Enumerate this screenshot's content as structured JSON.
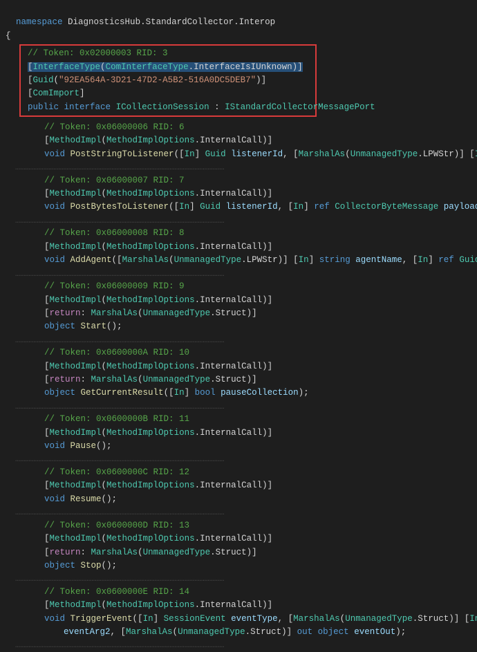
{
  "ns_kw": "namespace",
  "ns_name": "DiagnosticsHub.StandardCollector.Interop",
  "brace_open": "{",
  "brace_close": "}",
  "header": {
    "cmt": "// Token: 0x02000003 RID: 3",
    "it_attr_open": "[",
    "it_attr": "InterfaceType",
    "it_attr_arg_ns": "ComInterfaceType",
    "dot": ".",
    "it_attr_arg_mem": "InterfaceIsIUnknown",
    "it_attr_close": ")]",
    "guid_attr_open": "[",
    "guid_attr": "Guid",
    "guid_lpar": "(",
    "guid_str": "\"92EA564A-3D21-47D2-A5B2-516A0DC5DEB7\"",
    "guid_close": ")]",
    "comimport": "[ComImport]",
    "pub": "public",
    "iface": "interface",
    "iname": "ICollectionSession",
    "colon": " : ",
    "base": "IStandardCollectorMessagePort"
  },
  "mi_attr": "[MethodImpl(MethodImplOptions.InternalCall)]",
  "ret_attr": "[return: MarshalAs(UnmanagedType.Struct)]",
  "m6": {
    "cmt": "// Token: 0x06000006 RID: 6",
    "sig": "void PostStringToListener([In] Guid listenerId, [MarshalAs(UnmanagedType.LPWStr)] [In] string payload);"
  },
  "m7": {
    "cmt": "// Token: 0x06000007 RID: 7",
    "sig": "void PostBytesToListener([In] Guid listenerId, [In] ref CollectorByteMessage payload);"
  },
  "m8": {
    "cmt": "// Token: 0x06000008 RID: 8",
    "sig": "void AddAgent([MarshalAs(UnmanagedType.LPWStr)] [In] string agentName, [In] ref Guid clsid);"
  },
  "m9": {
    "cmt": "// Token: 0x06000009 RID: 9",
    "sig": "object Start();"
  },
  "m10": {
    "cmt": "// Token: 0x0600000A RID: 10",
    "sig": "object GetCurrentResult([In] bool pauseCollection);"
  },
  "m11": {
    "cmt": "// Token: 0x0600000B RID: 11",
    "sig": "void Pause();"
  },
  "m12": {
    "cmt": "// Token: 0x0600000C RID: 12",
    "sig": "void Resume();"
  },
  "m13": {
    "cmt": "// Token: 0x0600000D RID: 13",
    "sig": "object Stop();"
  },
  "m14": {
    "cmt": "// Token: 0x0600000E RID: 14",
    "sig1": "void TriggerEvent([In] SessionEvent eventType, [MarshalAs(UnmanagedType.Struct)] [In] ref object eventAr",
    "sig2": "   eventArg2, [MarshalAs(UnmanagedType.Struct)] out object eventOut);"
  },
  "ghosts": {
    "g1": "…",
    "g2": "…",
    "g3": "…",
    "g4": "…",
    "g5": "…",
    "g6": "…",
    "g7": "…",
    "g8": "…",
    "g9": "…"
  },
  "ghost_long": "………………………………………………………………………………………………………………",
  "ghost_long2": "………………………………………………………………………………………………………………"
}
